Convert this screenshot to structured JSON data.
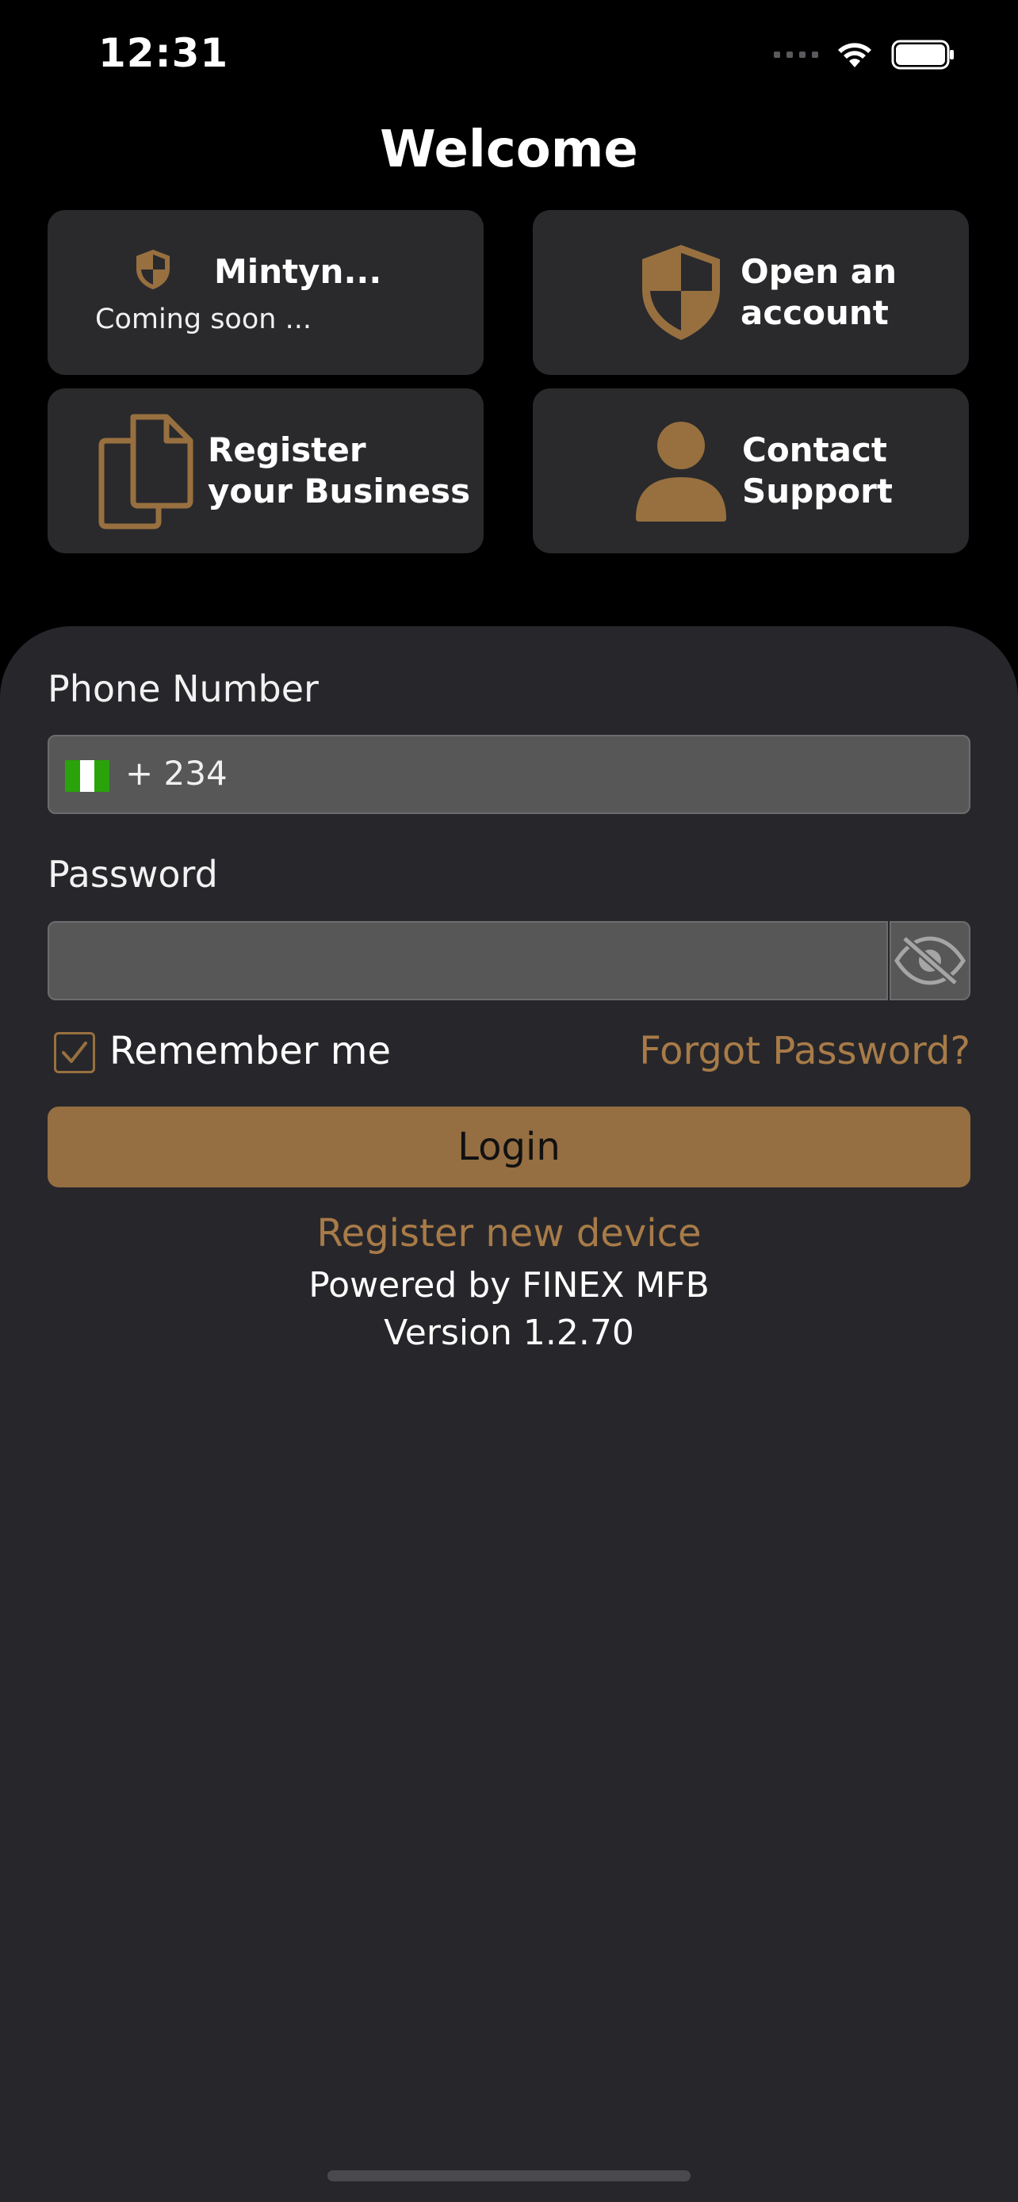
{
  "status_bar": {
    "time": "12:31"
  },
  "header": {
    "title": "Welcome"
  },
  "tiles": [
    {
      "label": "Mintyn...",
      "sublabel": "Coming soon ...",
      "icon": "shield-icon"
    },
    {
      "label_line1": "Open an",
      "label_line2": "account",
      "icon": "shield-icon"
    },
    {
      "label_line1": "Register",
      "label_line2": "your Business",
      "icon": "documents-icon"
    },
    {
      "label_line1": "Contact",
      "label_line2": "Support",
      "icon": "person-icon"
    }
  ],
  "form": {
    "phone_label": "Phone Number",
    "phone_prefix": "+ 234",
    "password_label": "Password",
    "remember_label": "Remember me",
    "forgot_label": "Forgot Password?",
    "login_label": "Login"
  },
  "footer": {
    "register_device": "Register new device",
    "powered_by": "Powered by FINEX MFB",
    "version": "Version 1.2.70"
  },
  "colors": {
    "accent": "#956e42",
    "link": "#a87b48",
    "sheet": "#27272b",
    "tile": "#2a2a2d"
  }
}
